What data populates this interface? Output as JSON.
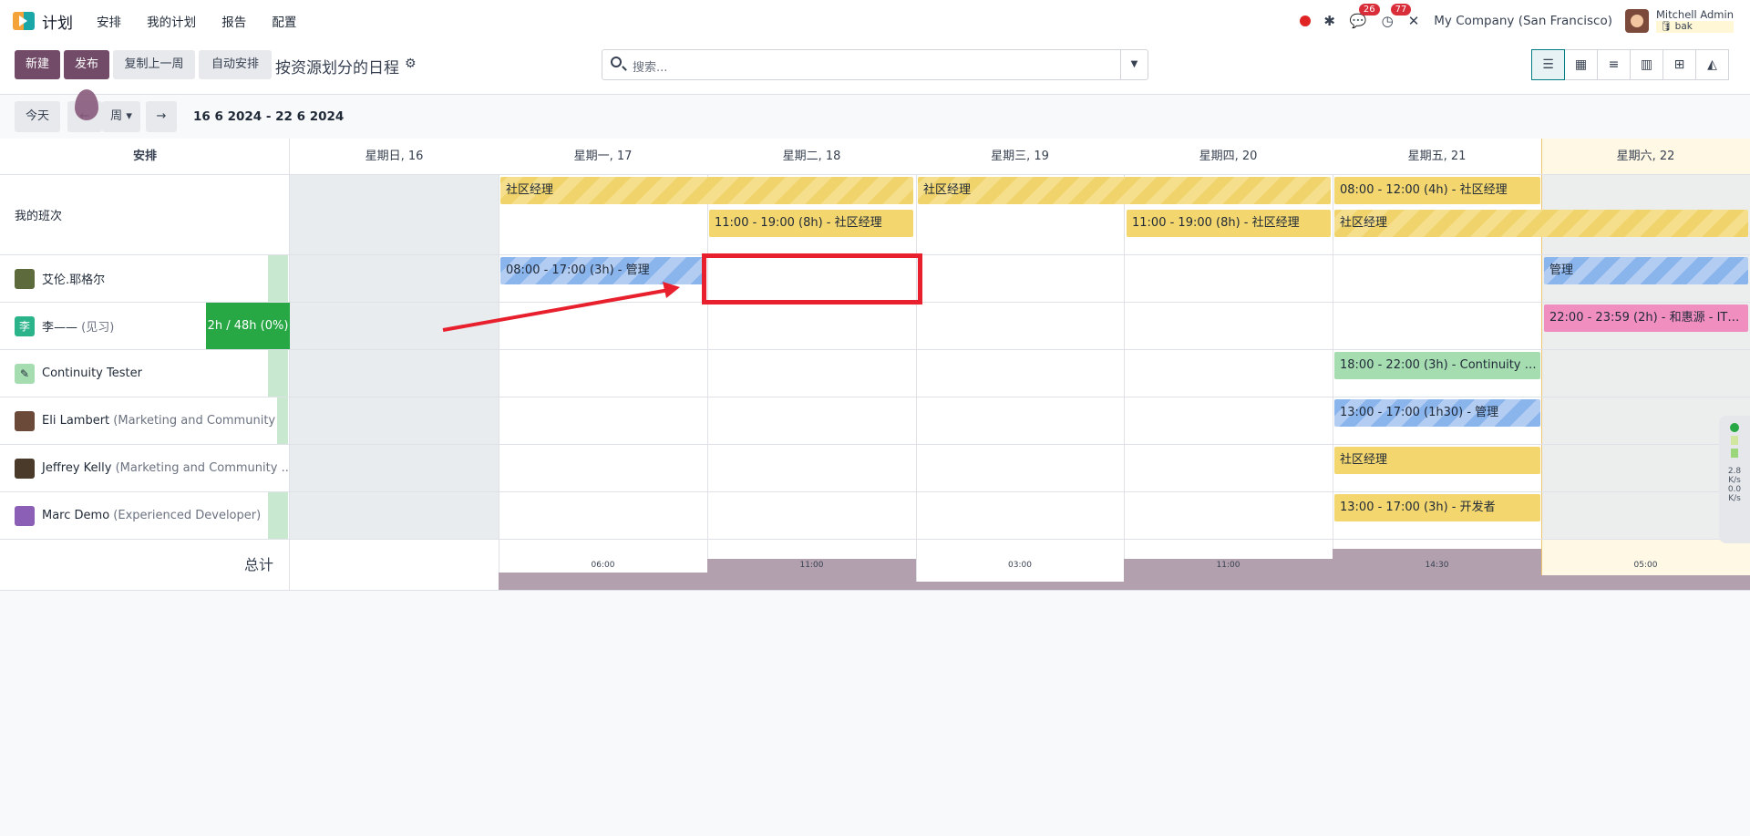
{
  "app": {
    "name": "计划",
    "menu": [
      "安排",
      "我的计划",
      "报告",
      "配置"
    ]
  },
  "topbar": {
    "chat_badge": "26",
    "activity_badge": "77",
    "company": "My Company (San Francisco)",
    "user_name": "Mitchell Admin",
    "user_db": "bak"
  },
  "control": {
    "new": "新建",
    "publish": "发布",
    "copy_prev": "复制上一周",
    "auto": "自动安排",
    "title": "按资源划分的日程",
    "search_placeholder": "搜索..."
  },
  "nav": {
    "today": "今天",
    "prev": "←",
    "scale": "周",
    "next": "→",
    "range": "16 6 2024 - 22 6 2024"
  },
  "grid": {
    "head": "安排",
    "days": [
      "星期日, 16",
      "星期一, 17",
      "星期二, 18",
      "星期三, 19",
      "星期四, 20",
      "星期五, 21",
      "星期六, 22"
    ],
    "my_shifts": "我的班次",
    "rows": [
      {
        "name": "艾伦.耶格尔",
        "sub": ""
      },
      {
        "name": "李——",
        "sub": "(见习)",
        "avatar_text": "李",
        "capacity": "2h / 48h (0%)"
      },
      {
        "name": "Continuity Tester",
        "sub": ""
      },
      {
        "name": "Eli Lambert",
        "sub": "(Marketing and Community ..."
      },
      {
        "name": "Jeffrey Kelly",
        "sub": "(Marketing and Community ..."
      },
      {
        "name": "Marc Demo",
        "sub": "(Experienced Developer)"
      }
    ],
    "pills": {
      "ms1": "社区经理",
      "ms2": "社区经理",
      "ms3": "08:00 - 12:00 (4h) - 社区经理",
      "ms4": "11:00 - 19:00 (8h) - 社区经理",
      "ms5": "11:00 - 19:00 (8h) - 社区经理",
      "ms6": "社区经理",
      "r1a": "08:00 - 17:00 (3h) - 管理",
      "r1b": "管理",
      "r2": "22:00 - 23:59 (2h) - 和惠源 - IT技...",
      "r3": "18:00 - 22:00 (3h) - Continuity Te...",
      "r4": "13:00 - 17:00 (1h30) - 管理",
      "r5": "社区经理",
      "r6": "13:00 - 17:00 (3h) - 开发者"
    },
    "total_label": "总计",
    "totals": [
      {
        "label": "06:00",
        "value": 6
      },
      {
        "label": "11:00",
        "value": 11
      },
      {
        "label": "03:00",
        "value": 3
      },
      {
        "label": "11:00",
        "value": 11
      },
      {
        "label": "14:30",
        "value": 14.5
      },
      {
        "label": "05:00",
        "value": 5
      }
    ]
  },
  "side_widget": {
    "up": "2.8",
    "up_unit": "K/s",
    "down": "0.0",
    "down_unit": "K/s"
  }
}
